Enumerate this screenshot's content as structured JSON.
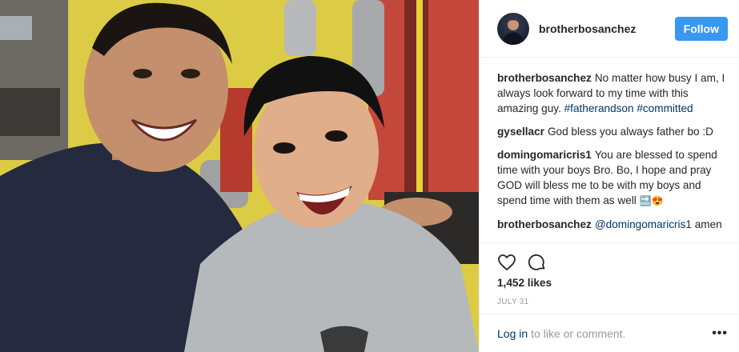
{
  "post": {
    "username": "brotherbosanchez",
    "follow_label": "Follow",
    "likes": "1,452 likes",
    "date": "JULY 31"
  },
  "comments": [
    {
      "user": "brotherbosanchez",
      "text": "No matter how busy I am, I always look forward to my time with this amazing guy.",
      "tags": [
        "#fatherandson",
        "#committed"
      ]
    },
    {
      "user": "gysellacr",
      "text": "God bless you always father bo :D"
    },
    {
      "user": "domingomaricris1",
      "text": "You are blessed to spend time with your boys Bro. Bo, I hope and pray GOD will bless me to be with my boys and spend time with them as well",
      "emoji": "🔜😍"
    },
    {
      "user": "brotherbosanchez",
      "mention": "@domingomaricris1",
      "text": "amen"
    }
  ],
  "footer": {
    "login": "Log in",
    "rest": "to like or comment.",
    "more": "•••"
  },
  "icons": {
    "like": "heart-icon",
    "comment": "comment-bubble-icon",
    "more": "ellipsis-icon"
  },
  "colors": {
    "follow_button": "#3897f0",
    "link": "#003569"
  }
}
